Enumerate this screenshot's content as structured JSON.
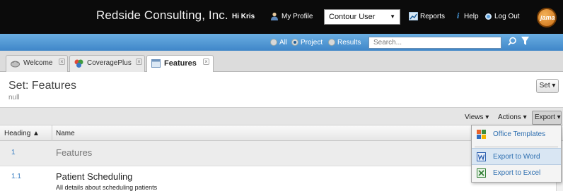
{
  "header": {
    "company": "Redside Consulting, Inc.",
    "greeting": "Hi Kris",
    "my_profile": "My Profile",
    "user_select": "Contour User",
    "reports": "Reports",
    "help": "Help",
    "logout": "Log Out",
    "logo_text": "jama"
  },
  "searchbar": {
    "scope_options": [
      "All",
      "Project",
      "Results"
    ],
    "selected_scope": "Project",
    "placeholder": "Search..."
  },
  "tabs": [
    {
      "label": "Welcome",
      "icon": "welcome-icon"
    },
    {
      "label": "CoveragePlus",
      "icon": "coverage-icon"
    },
    {
      "label": "Features",
      "icon": "features-icon",
      "active": true
    }
  ],
  "set": {
    "title": "Set: Features",
    "subtitle": "null",
    "button": "Set ▾"
  },
  "toolbar": {
    "views": "Views ▾",
    "actions": "Actions ▾",
    "export": "Export ▾"
  },
  "table": {
    "columns": [
      "Heading ▲",
      "Name"
    ],
    "rows": [
      {
        "heading": "1",
        "name": "Features",
        "description": ""
      },
      {
        "heading": "1.1",
        "name": "Patient Scheduling",
        "description": "All details about scheduling patients"
      }
    ]
  },
  "export_menu": {
    "items": [
      {
        "label": "Office Templates",
        "icon": "office-templates-icon"
      },
      {
        "label": "Export to Word",
        "icon": "word-icon",
        "highlighted": true
      },
      {
        "label": "Export to Excel",
        "icon": "excel-icon"
      }
    ]
  },
  "colors": {
    "header_bg": "#0b0b0b",
    "search_strip": "#4f95d2",
    "link_blue": "#3a7fc2",
    "menu_highlight": "#d9e6f3"
  }
}
